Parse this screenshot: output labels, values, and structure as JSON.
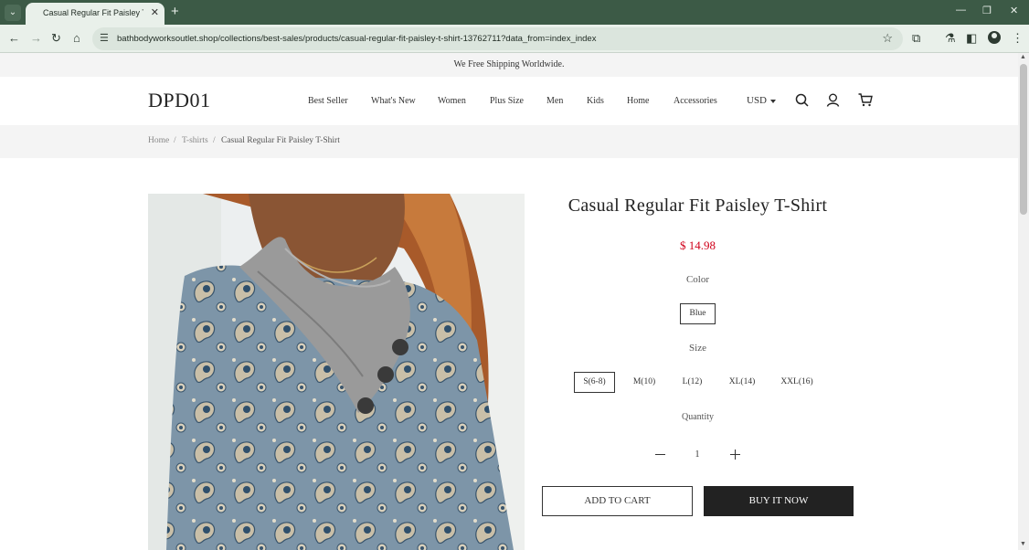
{
  "browser": {
    "tab_title": "Casual Regular Fit Paisley T-Shirt",
    "url": "bathbodyworksoutlet.shop/collections/best-sales/products/casual-regular-fit-paisley-t-shirt-13762711?data_from=index_index",
    "icons": [
      "back-icon",
      "forward-icon",
      "reload-icon",
      "home-icon",
      "site-info-icon",
      "bookmark-star-icon",
      "extensions-icon",
      "profile-icon",
      "menu-icon"
    ]
  },
  "site": {
    "announcement": "We Free Shipping Worldwide.",
    "logo": "DPD01",
    "nav": [
      "Best Seller",
      "What's New",
      "Women",
      "Plus Size",
      "Men",
      "Kids",
      "Home",
      "Accessories"
    ],
    "currency": "USD"
  },
  "breadcrumb": {
    "home": "Home",
    "sep": "/",
    "category": "T-shirts",
    "current": "Casual Regular Fit Paisley T-Shirt"
  },
  "product": {
    "title": "Casual Regular Fit Paisley T-Shirt",
    "price": "$ 14.98",
    "color_label": "Color",
    "colors": [
      "Blue"
    ],
    "selected_color": "Blue",
    "size_label": "Size",
    "sizes": [
      "S(6-8)",
      "M(10)",
      "L(12)",
      "XL(14)",
      "XXL(16)"
    ],
    "selected_size": "S(6-8)",
    "quantity_label": "Quantity",
    "quantity": "1",
    "add_to_cart": "ADD TO CART",
    "buy_now": "BUY IT NOW"
  },
  "colors": {
    "browser_frame": "#3c5a46",
    "toolbar": "#e9f0ea",
    "price_red": "#d0021b",
    "buy_button": "#222222"
  }
}
